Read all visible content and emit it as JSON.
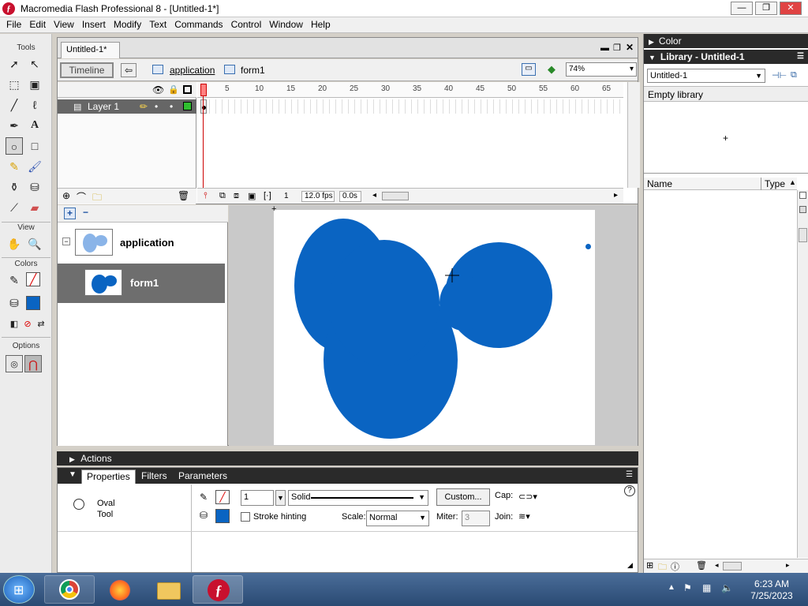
{
  "window": {
    "title": "Macromedia Flash Professional 8 - [Untitled-1*]",
    "icon": "flash-icon"
  },
  "menu": [
    "File",
    "Edit",
    "View",
    "Insert",
    "Modify",
    "Text",
    "Commands",
    "Control",
    "Window",
    "Help"
  ],
  "toolbox": {
    "tools_label": "Tools",
    "view_label": "View",
    "colors_label": "Colors",
    "options_label": "Options"
  },
  "document": {
    "tab": "Untitled-1*",
    "timeline_button": "Timeline",
    "breadcrumb": [
      "application",
      "form1"
    ],
    "zoom": "74%"
  },
  "timeline": {
    "frame_ticks": [
      "1",
      "5",
      "10",
      "15",
      "20",
      "25",
      "30",
      "35",
      "40",
      "45",
      "50",
      "55",
      "60",
      "65"
    ],
    "layer_name": "Layer 1",
    "current_frame": "1",
    "fps": "12.0 fps",
    "elapsed": "0.0s"
  },
  "scenes": [
    {
      "name": "application",
      "selected": false
    },
    {
      "name": "form1",
      "selected": true
    }
  ],
  "stage": {
    "shape_color": "#0a64c2"
  },
  "actions": {
    "label": "Actions"
  },
  "properties": {
    "tabs": [
      "Properties",
      "Filters",
      "Parameters"
    ],
    "tool_name": "Oval",
    "tool_sub": "Tool",
    "stroke_height": "1",
    "stroke_style": "Solid",
    "custom_button": "Custom...",
    "cap_label": "Cap:",
    "stroke_hinting": "Stroke hinting",
    "scale_label": "Scale:",
    "scale_value": "Normal",
    "miter_label": "Miter:",
    "miter_value": "3",
    "join_label": "Join:"
  },
  "color_panel": {
    "title": "Color"
  },
  "library": {
    "title": "Library - Untitled-1",
    "document": "Untitled-1",
    "empty": "Empty library",
    "col_name": "Name",
    "col_type": "Type"
  },
  "taskbar": {
    "time": "6:23 AM",
    "date": "7/25/2023"
  }
}
